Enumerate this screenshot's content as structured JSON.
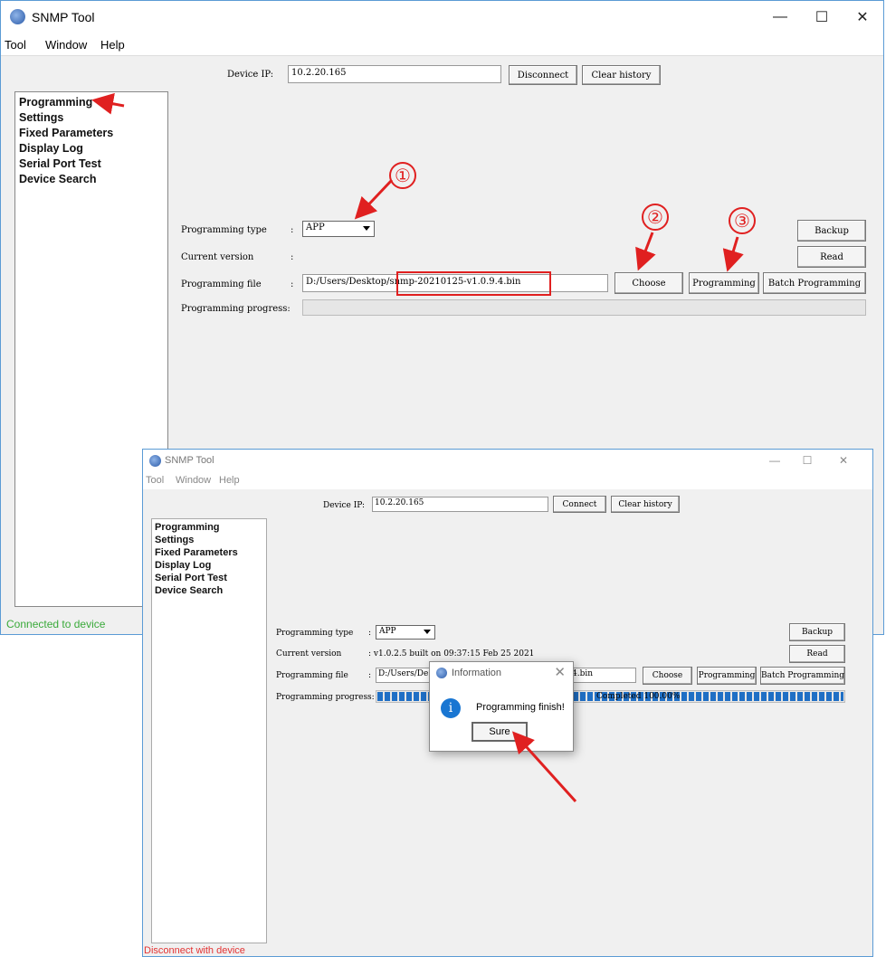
{
  "window1": {
    "title": "SNMP Tool",
    "title_controls": {
      "minimize": "—",
      "maximize": "☐",
      "close": "✕"
    },
    "menu": [
      "Tool",
      "Window",
      "Help"
    ],
    "device_ip_label": "Device IP:",
    "device_ip_value": "10.2.20.165",
    "connect_button": "Disconnect",
    "clear_history_button": "Clear history",
    "nav_items": [
      "Programming",
      "Settings",
      "Fixed Parameters",
      "Display Log",
      "Serial Port Test",
      "Device Search"
    ],
    "programming_type_label": "Programming type",
    "colon": ":",
    "programming_type_value": "APP",
    "current_version_label": "Current version",
    "current_version_value": "",
    "programming_file_label": "Programming file",
    "programming_file_value": "D:/Users/Desktop/snmp-20210125-v1.0.9.4.bin",
    "programming_progress_label": "Programming progress:",
    "progress_fraction": 0,
    "buttons": {
      "backup": "Backup",
      "read": "Read",
      "choose": "Choose",
      "programming": "Programming",
      "batch": "Batch Programming"
    },
    "status": "Connected to device",
    "status_color": "#3aaa3a"
  },
  "window2": {
    "title": "SNMP Tool",
    "title_controls": {
      "minimize": "—",
      "maximize": "☐",
      "close": "✕"
    },
    "menu": [
      "Tool",
      "Window",
      "Help"
    ],
    "device_ip_label": "Device IP:",
    "device_ip_value": "10.2.20.165",
    "connect_button": "Connect",
    "clear_history_button": "Clear history",
    "nav_items": [
      "Programming",
      "Settings",
      "Fixed Parameters",
      "Display Log",
      "Serial Port Test",
      "Device Search"
    ],
    "programming_type_label": "Programming type",
    "colon": ":",
    "programming_type_value": "APP",
    "current_version_label": "Current version",
    "current_version_value": ": v1.0.2.5 built on 09:37:15 Feb 25 2021",
    "programming_file_label": "Programming file",
    "programming_file_value": "D:/Users/De",
    "programming_file_tail": "4.bin",
    "programming_progress_label": "Programming progress:",
    "progress_fraction": 1.0,
    "progress_text": "Completed 100.00%",
    "buttons": {
      "backup": "Backup",
      "read": "Read",
      "choose": "Choose",
      "programming": "Programming",
      "batch": "Batch Programming"
    },
    "status": "Disconnect with device",
    "status_color": "#e33333"
  },
  "dialog": {
    "title": "Information",
    "close": "✕",
    "info_glyph": "i",
    "message": "Programming finish!",
    "ok_button": "Sure"
  },
  "annotations": {
    "step1": "①",
    "step2": "②",
    "step3": "③",
    "color": "#e02020"
  }
}
